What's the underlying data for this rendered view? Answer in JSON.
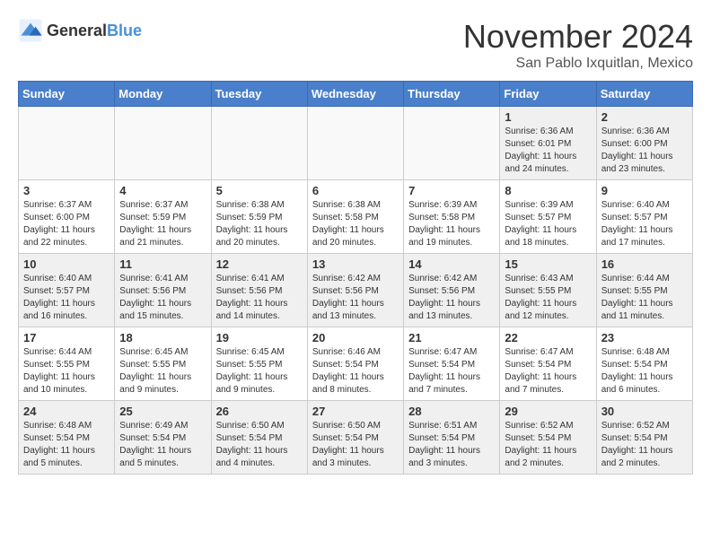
{
  "header": {
    "logo_general": "General",
    "logo_blue": "Blue",
    "month_title": "November 2024",
    "location": "San Pablo Ixquitlan, Mexico"
  },
  "days_of_week": [
    "Sunday",
    "Monday",
    "Tuesday",
    "Wednesday",
    "Thursday",
    "Friday",
    "Saturday"
  ],
  "weeks": [
    [
      {
        "day": "",
        "info": "",
        "empty": true
      },
      {
        "day": "",
        "info": "",
        "empty": true
      },
      {
        "day": "",
        "info": "",
        "empty": true
      },
      {
        "day": "",
        "info": "",
        "empty": true
      },
      {
        "day": "",
        "info": "",
        "empty": true
      },
      {
        "day": "1",
        "info": "Sunrise: 6:36 AM\nSunset: 6:01 PM\nDaylight: 11 hours and 24 minutes."
      },
      {
        "day": "2",
        "info": "Sunrise: 6:36 AM\nSunset: 6:00 PM\nDaylight: 11 hours and 23 minutes."
      }
    ],
    [
      {
        "day": "3",
        "info": "Sunrise: 6:37 AM\nSunset: 6:00 PM\nDaylight: 11 hours and 22 minutes."
      },
      {
        "day": "4",
        "info": "Sunrise: 6:37 AM\nSunset: 5:59 PM\nDaylight: 11 hours and 21 minutes."
      },
      {
        "day": "5",
        "info": "Sunrise: 6:38 AM\nSunset: 5:59 PM\nDaylight: 11 hours and 20 minutes."
      },
      {
        "day": "6",
        "info": "Sunrise: 6:38 AM\nSunset: 5:58 PM\nDaylight: 11 hours and 20 minutes."
      },
      {
        "day": "7",
        "info": "Sunrise: 6:39 AM\nSunset: 5:58 PM\nDaylight: 11 hours and 19 minutes."
      },
      {
        "day": "8",
        "info": "Sunrise: 6:39 AM\nSunset: 5:57 PM\nDaylight: 11 hours and 18 minutes."
      },
      {
        "day": "9",
        "info": "Sunrise: 6:40 AM\nSunset: 5:57 PM\nDaylight: 11 hours and 17 minutes."
      }
    ],
    [
      {
        "day": "10",
        "info": "Sunrise: 6:40 AM\nSunset: 5:57 PM\nDaylight: 11 hours and 16 minutes."
      },
      {
        "day": "11",
        "info": "Sunrise: 6:41 AM\nSunset: 5:56 PM\nDaylight: 11 hours and 15 minutes."
      },
      {
        "day": "12",
        "info": "Sunrise: 6:41 AM\nSunset: 5:56 PM\nDaylight: 11 hours and 14 minutes."
      },
      {
        "day": "13",
        "info": "Sunrise: 6:42 AM\nSunset: 5:56 PM\nDaylight: 11 hours and 13 minutes."
      },
      {
        "day": "14",
        "info": "Sunrise: 6:42 AM\nSunset: 5:56 PM\nDaylight: 11 hours and 13 minutes."
      },
      {
        "day": "15",
        "info": "Sunrise: 6:43 AM\nSunset: 5:55 PM\nDaylight: 11 hours and 12 minutes."
      },
      {
        "day": "16",
        "info": "Sunrise: 6:44 AM\nSunset: 5:55 PM\nDaylight: 11 hours and 11 minutes."
      }
    ],
    [
      {
        "day": "17",
        "info": "Sunrise: 6:44 AM\nSunset: 5:55 PM\nDaylight: 11 hours and 10 minutes."
      },
      {
        "day": "18",
        "info": "Sunrise: 6:45 AM\nSunset: 5:55 PM\nDaylight: 11 hours and 9 minutes."
      },
      {
        "day": "19",
        "info": "Sunrise: 6:45 AM\nSunset: 5:55 PM\nDaylight: 11 hours and 9 minutes."
      },
      {
        "day": "20",
        "info": "Sunrise: 6:46 AM\nSunset: 5:54 PM\nDaylight: 11 hours and 8 minutes."
      },
      {
        "day": "21",
        "info": "Sunrise: 6:47 AM\nSunset: 5:54 PM\nDaylight: 11 hours and 7 minutes."
      },
      {
        "day": "22",
        "info": "Sunrise: 6:47 AM\nSunset: 5:54 PM\nDaylight: 11 hours and 7 minutes."
      },
      {
        "day": "23",
        "info": "Sunrise: 6:48 AM\nSunset: 5:54 PM\nDaylight: 11 hours and 6 minutes."
      }
    ],
    [
      {
        "day": "24",
        "info": "Sunrise: 6:48 AM\nSunset: 5:54 PM\nDaylight: 11 hours and 5 minutes."
      },
      {
        "day": "25",
        "info": "Sunrise: 6:49 AM\nSunset: 5:54 PM\nDaylight: 11 hours and 5 minutes."
      },
      {
        "day": "26",
        "info": "Sunrise: 6:50 AM\nSunset: 5:54 PM\nDaylight: 11 hours and 4 minutes."
      },
      {
        "day": "27",
        "info": "Sunrise: 6:50 AM\nSunset: 5:54 PM\nDaylight: 11 hours and 3 minutes."
      },
      {
        "day": "28",
        "info": "Sunrise: 6:51 AM\nSunset: 5:54 PM\nDaylight: 11 hours and 3 minutes."
      },
      {
        "day": "29",
        "info": "Sunrise: 6:52 AM\nSunset: 5:54 PM\nDaylight: 11 hours and 2 minutes."
      },
      {
        "day": "30",
        "info": "Sunrise: 6:52 AM\nSunset: 5:54 PM\nDaylight: 11 hours and 2 minutes."
      }
    ]
  ]
}
